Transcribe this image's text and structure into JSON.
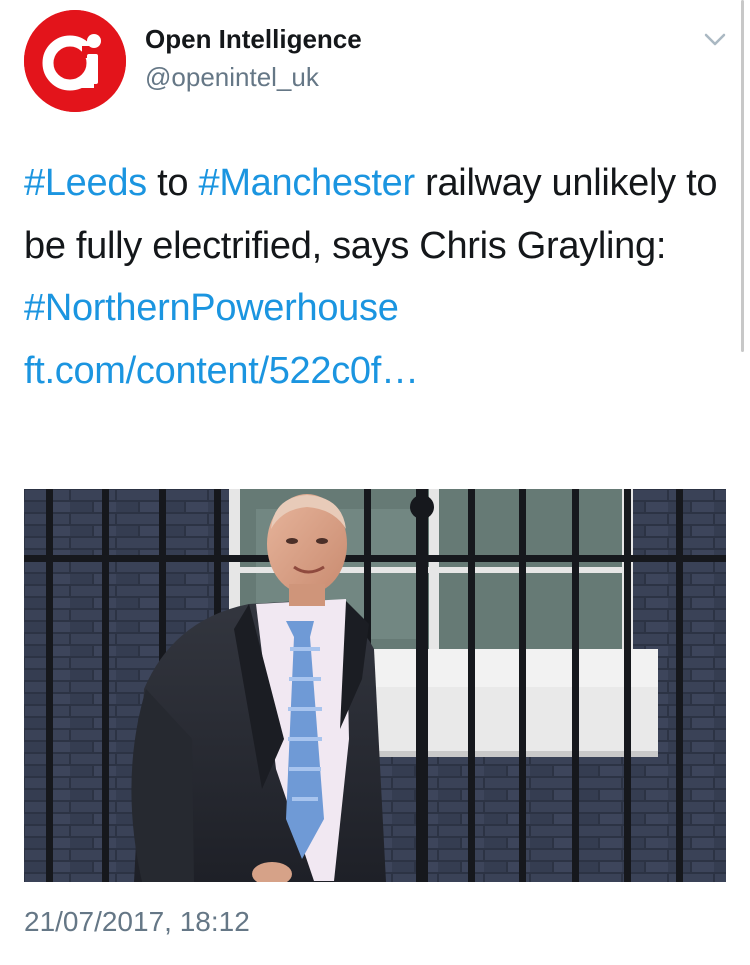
{
  "author": {
    "display_name": "Open Intelligence",
    "handle": "@openintel_uk",
    "avatar_logo": "oi-logo",
    "avatar_color": "#e3141b"
  },
  "tweet": {
    "segments": [
      {
        "text": "#Leeds",
        "type": "hashtag"
      },
      {
        "text": " to ",
        "type": "text"
      },
      {
        "text": "#Manchester",
        "type": "hashtag"
      },
      {
        "text": " railway unlikely to be fully electrified, says Chris Grayling: ",
        "type": "text"
      },
      {
        "text": "#NorthernPowerhouse",
        "type": "hashtag"
      },
      {
        "text": " ",
        "type": "text"
      },
      {
        "text": "ft.com/content/522c0f…",
        "type": "url"
      }
    ],
    "link_color": "#1b95e0"
  },
  "media": {
    "icon": "photo-of-man-outside-black-door-railings"
  },
  "timestamp": "21/07/2017, 18:12",
  "menu": {
    "icon": "chevron-down-icon"
  }
}
